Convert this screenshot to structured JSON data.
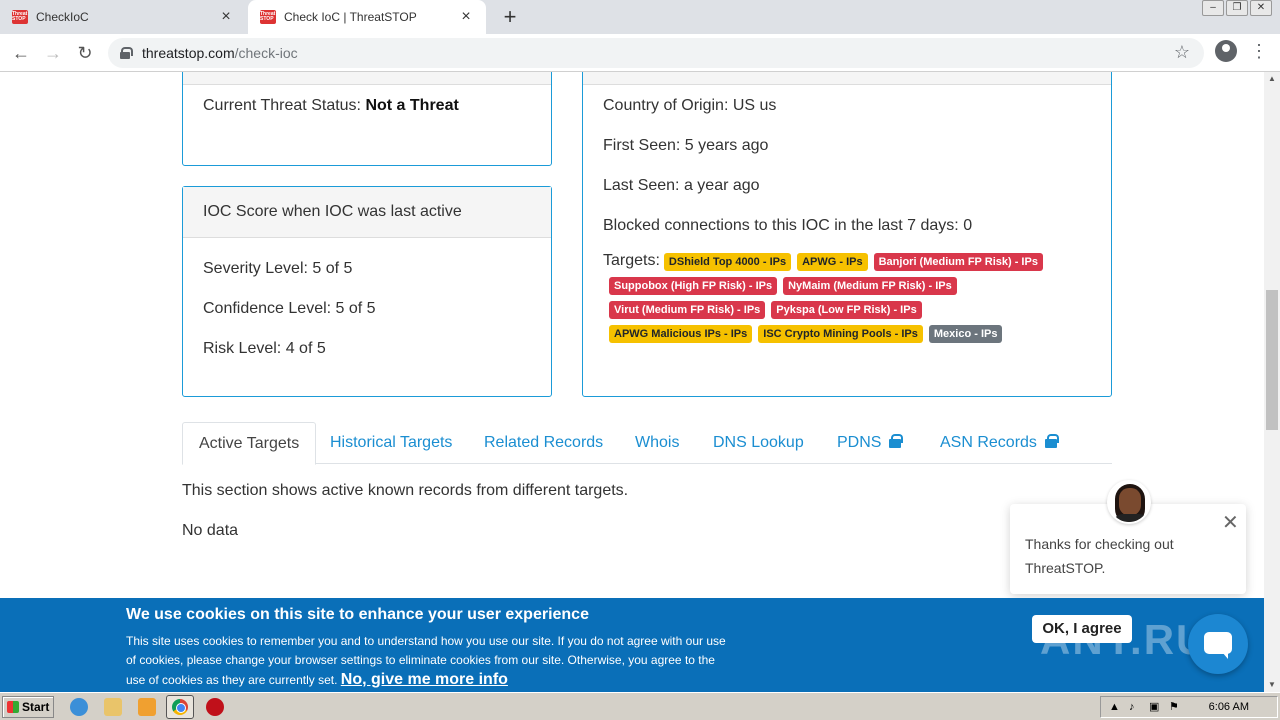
{
  "browser": {
    "tabs": [
      {
        "title": "CheckIoC",
        "favicon_text": "Threat STOP"
      },
      {
        "title": "Check IoC | ThreatSTOP",
        "favicon_text": "Threat STOP"
      }
    ],
    "new_tab_symbol": "+",
    "url_domain": "threatstop.com",
    "url_path": "/check-ioc",
    "window_controls": [
      "–",
      "❐",
      "✕"
    ]
  },
  "status_card": {
    "label": "Current Threat Status:",
    "value": "Not a Threat"
  },
  "score_card": {
    "header": "IOC Score when IOC was last active",
    "severity": "Severity Level: 5 of 5",
    "confidence": "Confidence Level: 5 of 5",
    "risk": "Risk Level: 4 of 5"
  },
  "info_card": {
    "country": "Country of Origin: US us",
    "first_seen": "First Seen: 5 years ago",
    "last_seen": "Last Seen: a year ago",
    "blocked": "Blocked connections to this IOC in the last 7 days: 0",
    "targets_label": "Targets:",
    "targets": [
      {
        "label": "DShield Top 4000 - IPs",
        "color": "#f6c100"
      },
      {
        "label": "APWG - IPs",
        "color": "#f6c100"
      },
      {
        "label": "Banjori (Medium FP Risk) - IPs",
        "color": "#d9374b"
      },
      {
        "label": "Suppobox (High FP Risk) - IPs",
        "color": "#d9374b"
      },
      {
        "label": "NyMaim (Medium FP Risk) - IPs",
        "color": "#d9374b"
      },
      {
        "label": "Virut (Medium FP Risk) - IPs",
        "color": "#d9374b"
      },
      {
        "label": "Pykspa (Low FP Risk) - IPs",
        "color": "#d9374b"
      },
      {
        "label": "APWG Malicious IPs - IPs",
        "color": "#f6c100"
      },
      {
        "label": "ISC Crypto Mining Pools - IPs",
        "color": "#f6c100"
      },
      {
        "label": "Mexico - IPs",
        "color": "#6c757d"
      }
    ]
  },
  "nav_tabs": [
    {
      "label": "Active Targets",
      "locked": false,
      "active": true
    },
    {
      "label": "Historical Targets",
      "locked": false,
      "active": false
    },
    {
      "label": "Related Records",
      "locked": false,
      "active": false
    },
    {
      "label": "Whois",
      "locked": false,
      "active": false
    },
    {
      "label": "DNS Lookup",
      "locked": false,
      "active": false
    },
    {
      "label": "PDNS",
      "locked": true,
      "active": false
    },
    {
      "label": "ASN Records",
      "locked": true,
      "active": false
    }
  ],
  "section": {
    "description": "This section shows active known records from different targets.",
    "empty": "No data"
  },
  "chat": {
    "message": "Thanks for checking out ThreatSTOP.",
    "close_symbol": "✕"
  },
  "cookie": {
    "title": "We use cookies on this site to enhance your user experience",
    "body": "This site uses cookies to remember you and to understand how you use our site. If you do not agree with our use of cookies, please change your browser settings to eliminate cookies from our site. Otherwise, you agree to the use of cookies as they are currently set.",
    "link": "No, give me more info",
    "ok_button": "OK, I agree"
  },
  "taskbar": {
    "start_label": "Start",
    "clock": "6:06 AM"
  },
  "colors": {
    "accent": "#1b9bd8",
    "link": "#1b8ed1",
    "cookie_bg": "#0a6fb8"
  }
}
